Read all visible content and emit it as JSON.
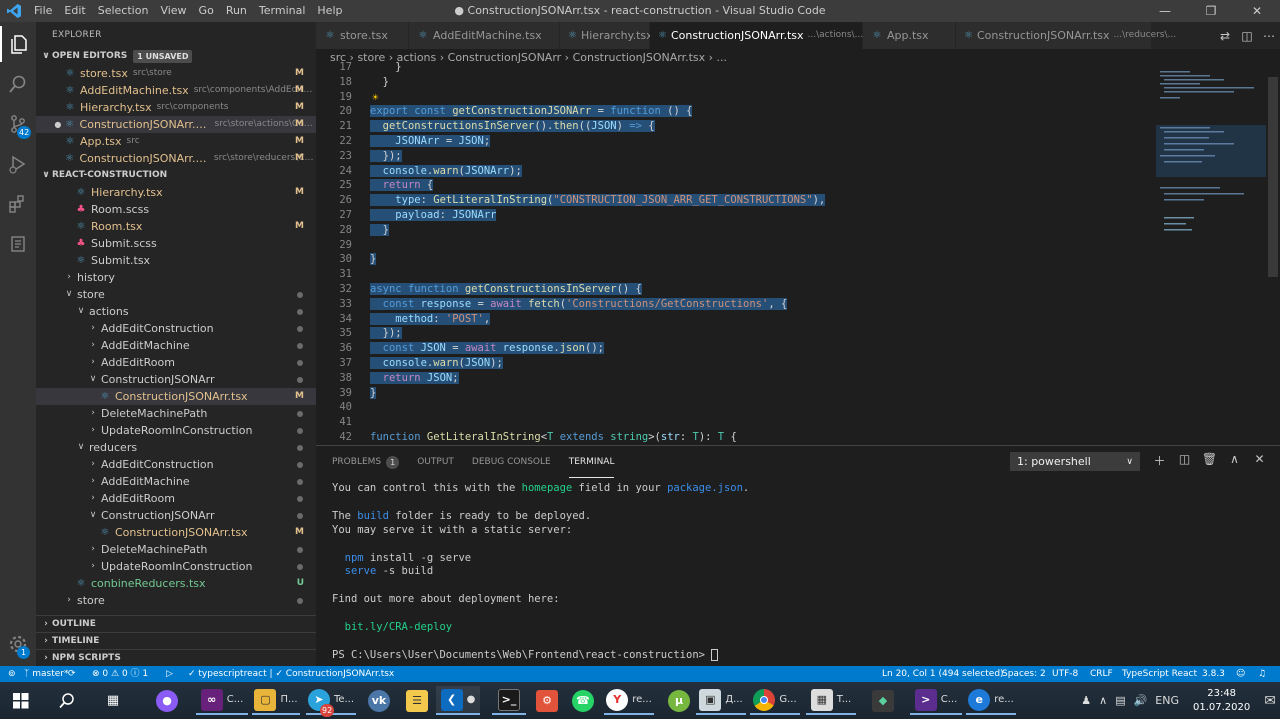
{
  "window": {
    "title": "● ConstructionJSONArr.tsx - react-construction - Visual Studio Code",
    "menu": [
      "File",
      "Edit",
      "Selection",
      "View",
      "Go",
      "Run",
      "Terminal",
      "Help"
    ]
  },
  "activity_bar": {
    "scm_badge": "42",
    "settings_badge": "1"
  },
  "explorer": {
    "header": "EXPLORER",
    "open_editors_label": "OPEN EDITORS",
    "unsaved_badge": "1 UNSAVED",
    "open_editors": [
      {
        "name": "store.tsx",
        "desc": "src\\store",
        "status": "M"
      },
      {
        "name": "AddEditMachine.tsx",
        "desc": "src\\components\\AddEditM...",
        "status": "M"
      },
      {
        "name": "Hierarchy.tsx",
        "desc": "src\\components",
        "status": "M"
      },
      {
        "name": "ConstructionJSONArr.tsx",
        "desc": "src\\store\\actions\\Con...",
        "status": "M"
      },
      {
        "name": "App.tsx",
        "desc": "src",
        "status": "M"
      },
      {
        "name": "ConstructionJSONArr.tsx",
        "desc": "src\\store\\reducers\\Co...",
        "status": "M"
      }
    ],
    "project_label": "REACT-CONSTRUCTION",
    "tree": [
      {
        "name": "Hierarchy.tsx",
        "status": "M"
      },
      {
        "name": "Room.scss",
        "status": ""
      },
      {
        "name": "Room.tsx",
        "status": "M"
      },
      {
        "name": "Submit.scss",
        "status": ""
      },
      {
        "name": "Submit.tsx",
        "status": ""
      },
      {
        "name": "history",
        "status": ""
      },
      {
        "name": "store",
        "status": ""
      },
      {
        "name": "actions",
        "status": ""
      },
      {
        "name": "AddEditConstruction",
        "status": ""
      },
      {
        "name": "AddEditMachine",
        "status": ""
      },
      {
        "name": "AddEditRoom",
        "status": ""
      },
      {
        "name": "ConstructionJSONArr",
        "status": ""
      },
      {
        "name": "ConstructionJSONArr.tsx",
        "status": "M"
      },
      {
        "name": "DeleteMachinePath",
        "status": ""
      },
      {
        "name": "UpdateRoomInConstruction",
        "status": ""
      },
      {
        "name": "reducers",
        "status": ""
      },
      {
        "name": "AddEditConstruction",
        "status": ""
      },
      {
        "name": "AddEditMachine",
        "status": ""
      },
      {
        "name": "AddEditRoom",
        "status": ""
      },
      {
        "name": "ConstructionJSONArr",
        "status": ""
      },
      {
        "name": "ConstructionJSONArr.tsx",
        "status": "M"
      },
      {
        "name": "DeleteMachinePath",
        "status": ""
      },
      {
        "name": "UpdateRoomInConstruction",
        "status": ""
      },
      {
        "name": "conbineReducers.tsx",
        "status": "U"
      },
      {
        "name": "store",
        "status": ""
      }
    ],
    "bottom_sections": [
      "OUTLINE",
      "TIMELINE",
      "NPM SCRIPTS"
    ]
  },
  "tabs": [
    {
      "name": "store.tsx",
      "desc": ""
    },
    {
      "name": "AddEditMachine.tsx",
      "desc": ""
    },
    {
      "name": "Hierarchy.tsx",
      "desc": ""
    },
    {
      "name": "ConstructionJSONArr.tsx",
      "desc": "...\\actions\\..."
    },
    {
      "name": "App.tsx",
      "desc": ""
    },
    {
      "name": "ConstructionJSONArr.tsx",
      "desc": "...\\reducers\\..."
    }
  ],
  "breadcrumb": "src  ›  store  ›  actions  ›  ConstructionJSONArr  ›  ConstructionJSONArr.tsx  ›  ...",
  "code": {
    "line_numbers": [
      "17",
      "18",
      "19",
      "20",
      "21",
      "22",
      "23",
      "24",
      "25",
      "26",
      "27",
      "28",
      "29",
      "30",
      "31",
      "32",
      "33",
      "34",
      "35",
      "36",
      "37",
      "38",
      "39",
      "40",
      "41",
      "42"
    ]
  },
  "panel": {
    "tabs": [
      "PROBLEMS",
      "OUTPUT",
      "DEBUG CONSOLE",
      "TERMINAL"
    ],
    "problems_count": "1",
    "terminal_select": "1: powershell",
    "terminal_lines": [
      "You can control this with the homepage field in your package.json.",
      "",
      "The build folder is ready to be deployed.",
      "You may serve it with a static server:",
      "",
      "  npm install -g serve",
      "  serve -s build",
      "",
      "Find out more about deployment here:",
      "",
      "  bit.ly/CRA-deploy",
      "",
      "PS C:\\Users\\User\\Documents\\Web\\Frontend\\react-construction> "
    ]
  },
  "status_bar": {
    "branch": "master*",
    "errors": "0",
    "warnings": "0",
    "info": "1",
    "language_context": "typescriptreact",
    "file_context": "ConstructionJSONArr.tsx",
    "position": "Ln 20, Col 1 (494 selected)",
    "spaces": "Spaces: 2",
    "encoding": "UTF-8",
    "eol": "CRLF",
    "language": "TypeScript React",
    "ts_version": "3.8.3"
  },
  "taskbar": {
    "items": [
      "C...",
      "П...",
      "Te...",
      "",
      "",
      "",
      "",
      "",
      "re...",
      "",
      "Д...",
      "G...",
      "T...",
      "",
      "C...",
      "re..."
    ],
    "telegram_badge": "92",
    "lang": "ENG",
    "time": "23:48",
    "date": "01.07.2020"
  }
}
